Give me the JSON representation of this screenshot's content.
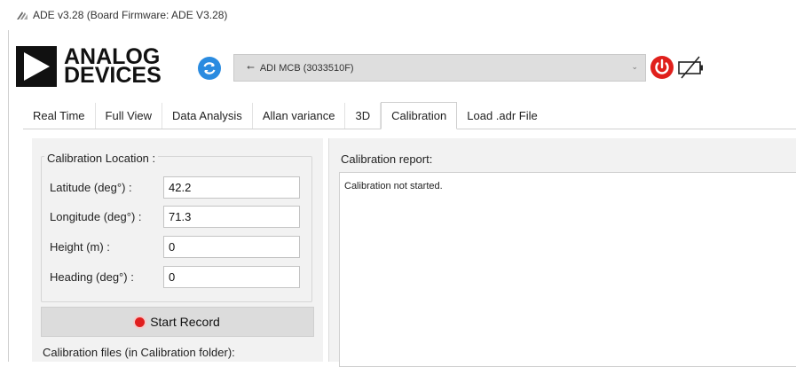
{
  "window": {
    "title": "ADE v3.28 (Board Firmware: ADE V3.28)"
  },
  "header": {
    "logo_line1": "ANALOG",
    "logo_line2": "DEVICES",
    "device_selected": "ADI MCB (3033510F)",
    "icons": [
      "refresh-icon",
      "usb-icon",
      "chevron-down-icon",
      "power-icon",
      "battery-disconnected-icon"
    ],
    "colors": {
      "refresh": "#2a8be0",
      "power": "#e0201c"
    }
  },
  "tabs": [
    {
      "label": "Real Time",
      "active": false
    },
    {
      "label": "Full View",
      "active": false
    },
    {
      "label": "Data Analysis",
      "active": false
    },
    {
      "label": "Allan variance",
      "active": false
    },
    {
      "label": "3D",
      "active": false
    },
    {
      "label": "Calibration",
      "active": true
    },
    {
      "label": "Load .adr File",
      "active": false
    }
  ],
  "calibration": {
    "location_group_label": "Calibration Location :",
    "fields": [
      {
        "label": "Latitude (deg°) :",
        "value": "42.2"
      },
      {
        "label": "Longitude (deg°) :",
        "value": "71.3"
      },
      {
        "label": "Height (m) :",
        "value": "0"
      },
      {
        "label": "Heading (deg°) :",
        "value": "0"
      }
    ],
    "record_button_label": "Start Record",
    "files_label": "Calibration files (in Calibration folder):",
    "report_label": "Calibration report:",
    "report_text": "Calibration not started."
  }
}
